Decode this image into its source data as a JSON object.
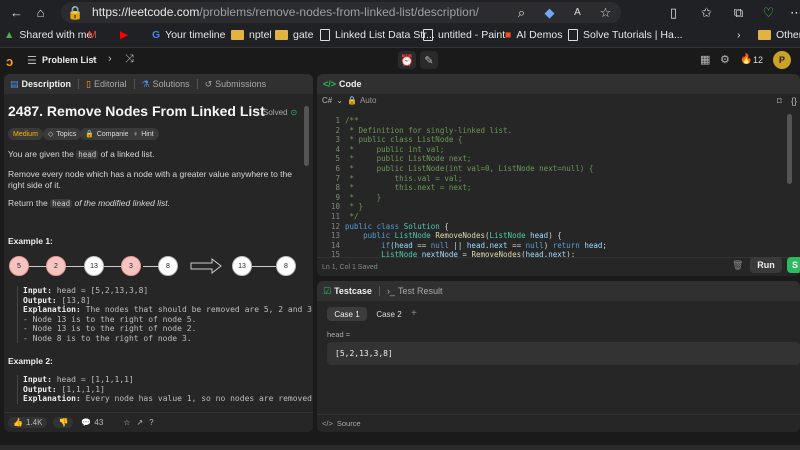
{
  "browser": {
    "url_host": "https://leetcode.com",
    "url_path": "/problems/remove-nodes-from-linked-list/description/",
    "bookmarks": [
      "Shared with me",
      "Your timeline",
      "nptel",
      "gate",
      "Linked List Data Str...",
      "untitled - Paint",
      "AI Demos",
      "Solve Tutorials | Ha...",
      "Other"
    ]
  },
  "lc_topbar": {
    "problem_list": "Problem List",
    "streak": "12",
    "avatar_letter": "P"
  },
  "problem": {
    "tabs": [
      "Description",
      "Editorial",
      "Solutions",
      "Submissions"
    ],
    "title": "2487. Remove Nodes From Linked List",
    "status": "Solved",
    "difficulty": "Medium",
    "chips": [
      "Topics",
      "Companies",
      "Hint"
    ],
    "p1_pre": "You are given the ",
    "p1_code": "head",
    "p1_post": " of a linked list.",
    "p2": "Remove every node which has a node with a greater value anywhere to the right side of it.",
    "p3_pre": "Return the ",
    "p3_code": "head",
    "p3_post": " of the modified linked list.",
    "example1_title": "Example 1:",
    "example1_input_nodes": [
      "5",
      "2",
      "13",
      "3",
      "8"
    ],
    "example1_output_nodes": [
      "13",
      "8"
    ],
    "example1_input": "head = [5,2,13,3,8]",
    "example1_output": "[13,8]",
    "example1_explanation": "The nodes that should be removed are 5, 2 and 3.",
    "example1_notes": [
      "- Node 13 is to the right of node 5.",
      "- Node 13 is to the right of node 2.",
      "- Node 8 is to the right of node 3."
    ],
    "example2_title": "Example 2:",
    "example2_input": "head = [1,1,1,1]",
    "example2_output": "[1,1,1,1]",
    "example2_explanation": "Every node has value 1, so no nodes are removed.",
    "labels": {
      "input": "Input:",
      "output": "Output:",
      "explanation": "Explanation:"
    },
    "likes": "1.4K",
    "comments": "43"
  },
  "code_panel": {
    "tab": "Code",
    "language": "C#",
    "mode": "Auto",
    "lines": [
      "/**",
      " * Definition for singly-linked list.",
      " * public class ListNode {",
      " *     public int val;",
      " *     public ListNode next;",
      " *     public ListNode(int val=0, ListNode next=null) {",
      " *         this.val = val;",
      " *         this.next = next;",
      " *     }",
      " * }",
      " */",
      "public class Solution {",
      "    public ListNode RemoveNodes(ListNode head) {",
      "        if(head == null || head.next == null) return head;",
      "        ListNode nextNode = RemoveNodes(head.next);"
    ],
    "status": "Ln 1, Col 1    Saved",
    "run": "Run",
    "submit": "S"
  },
  "test_panel": {
    "tabs": [
      "Testcase",
      "Test Result"
    ],
    "cases": [
      "Case 1",
      "Case 2"
    ],
    "field_label": "head =",
    "field_value": "[5,2,13,3,8]",
    "source": "Source"
  },
  "colors": {
    "accent": "#ffa116",
    "green": "#2cbb5d",
    "red_node": "#f6c4c0"
  }
}
